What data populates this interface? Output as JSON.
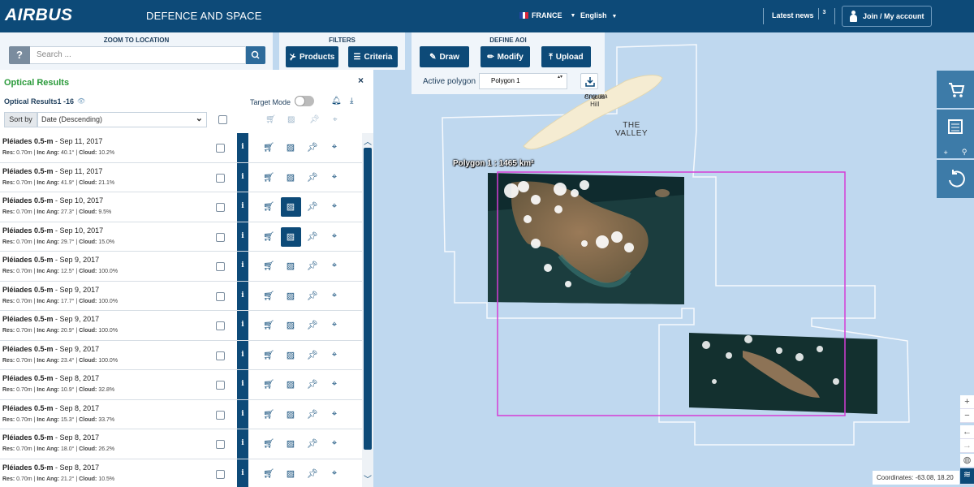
{
  "header": {
    "logo": "AIRBUS",
    "subtitle": "DEFENCE AND SPACE",
    "country": "FRANCE",
    "language": "English",
    "latest_news": "Latest news",
    "news_count": "3",
    "join": "Join / My account"
  },
  "zoom": {
    "title": "ZOOM TO LOCATION",
    "help": "?",
    "search_placeholder": "Search ..."
  },
  "filters": {
    "title": "FILTERS",
    "products": "Products",
    "criteria": "Criteria"
  },
  "aoi": {
    "title": "DEFINE AOI",
    "draw": "Draw",
    "modify": "Modify",
    "upload": "Upload",
    "active_label": "Active polygon",
    "active_value": "Polygon 1"
  },
  "results": {
    "title": "Optical Results",
    "close": "×",
    "subtitle": "Optical Results1 -16",
    "target_mode": "Target Mode",
    "target_mode_on": false,
    "sort_label": "Sort by",
    "sort_value": "Date (Descending)",
    "rows": [
      {
        "name": "Pléiades 0.5-m",
        "date": "Sep 11, 2017",
        "res": "0.70m",
        "inc": "40.1°",
        "cloud": "10.2%",
        "quicklook_active": false
      },
      {
        "name": "Pléiades 0.5-m",
        "date": "Sep 11, 2017",
        "res": "0.70m",
        "inc": "41.9°",
        "cloud": "21.1%",
        "quicklook_active": false
      },
      {
        "name": "Pléiades 0.5-m",
        "date": "Sep 10, 2017",
        "res": "0.70m",
        "inc": "27.3°",
        "cloud": "9.5%",
        "quicklook_active": true
      },
      {
        "name": "Pléiades 0.5-m",
        "date": "Sep 10, 2017",
        "res": "0.70m",
        "inc": "29.7°",
        "cloud": "15.0%",
        "quicklook_active": true
      },
      {
        "name": "Pléiades 0.5-m",
        "date": "Sep 9, 2017",
        "res": "0.70m",
        "inc": "12.5°",
        "cloud": "100.0%",
        "quicklook_active": false
      },
      {
        "name": "Pléiades 0.5-m",
        "date": "Sep 9, 2017",
        "res": "0.70m",
        "inc": "17.7°",
        "cloud": "100.0%",
        "quicklook_active": false
      },
      {
        "name": "Pléiades 0.5-m",
        "date": "Sep 9, 2017",
        "res": "0.70m",
        "inc": "20.9°",
        "cloud": "100.0%",
        "quicklook_active": false
      },
      {
        "name": "Pléiades 0.5-m",
        "date": "Sep 9, 2017",
        "res": "0.70m",
        "inc": "23.4°",
        "cloud": "100.0%",
        "quicklook_active": false
      },
      {
        "name": "Pléiades 0.5-m",
        "date": "Sep 8, 2017",
        "res": "0.70m",
        "inc": "10.9°",
        "cloud": "32.8%",
        "quicklook_active": false
      },
      {
        "name": "Pléiades 0.5-m",
        "date": "Sep 8, 2017",
        "res": "0.70m",
        "inc": "15.3°",
        "cloud": "33.7%",
        "quicklook_active": false
      },
      {
        "name": "Pléiades 0.5-m",
        "date": "Sep 8, 2017",
        "res": "0.70m",
        "inc": "18.0°",
        "cloud": "26.2%",
        "quicklook_active": false
      },
      {
        "name": "Pléiades 0.5-m",
        "date": "Sep 8, 2017",
        "res": "0.70m",
        "inc": "21.2°",
        "cloud": "10.5%",
        "quicklook_active": false
      }
    ],
    "labels": {
      "res": "Res:",
      "inc": "Inc Ang:",
      "cloud": "Cloud:",
      "info": "i"
    }
  },
  "map": {
    "polygon_label": "Polygon 1 : 1465 km²",
    "town_1": "Crocus",
    "town_2": "Hill",
    "town_3": "Anguilla",
    "valley_1": "THE",
    "valley_2": "VALLEY",
    "coordinates": "Coordinates: -63.08, 18.20",
    "polygon_color": "#d63cd6"
  },
  "colors": {
    "header": "#0d4a78",
    "accent": "#2a9a3a",
    "map_sea": "#bfd8ef"
  }
}
